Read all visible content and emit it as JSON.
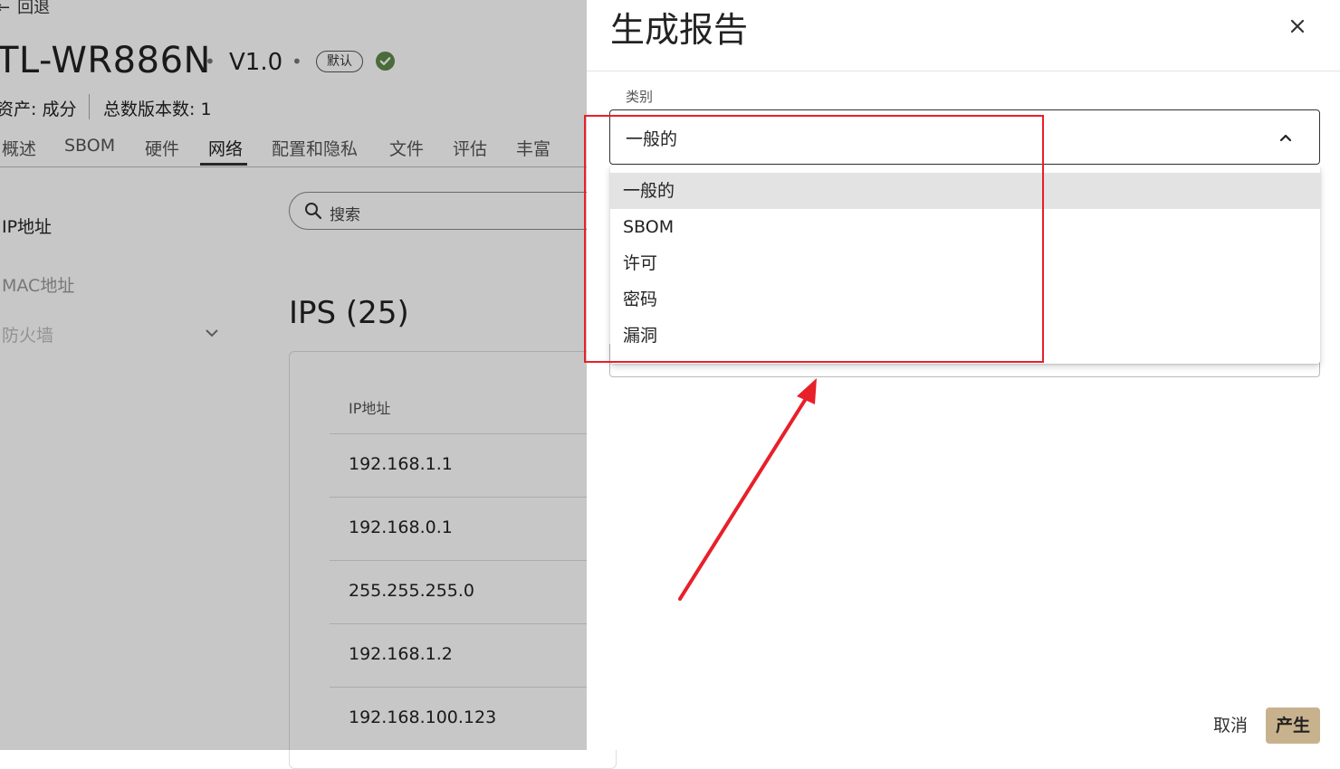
{
  "background": {
    "back_label": "回退",
    "device_name": "TL-WR886N",
    "version": "V1.0",
    "default_badge": "默认",
    "asset_line": "资产: 成分",
    "versions_count": "总数版本数: 1",
    "tabs": [
      "概述",
      "SBOM",
      "硬件",
      "网络",
      "配置和隐私",
      "文件",
      "评估",
      "丰富"
    ],
    "active_tab": "网络",
    "sidebar": {
      "ip": "IP地址",
      "mac": "MAC地址",
      "firewall": "防火墙"
    },
    "search_placeholder": "搜索",
    "ips_heading": "IPS (25)",
    "table": {
      "column": "IP地址",
      "rows": [
        "192.168.1.1",
        "192.168.0.1",
        "255.255.255.0",
        "192.168.1.2",
        "192.168.100.123"
      ]
    }
  },
  "drawer": {
    "title": "生成报告",
    "category_label": "类别",
    "selected_value": "一般的",
    "options": [
      "一般的",
      "SBOM",
      "许可",
      "密码",
      "漏洞"
    ],
    "cancel_label": "取消",
    "generate_label": "产生"
  },
  "colors": {
    "primary_button": "#c8b28e",
    "annotation_red": "#e8202a",
    "verified_green": "#5f8a4b"
  }
}
